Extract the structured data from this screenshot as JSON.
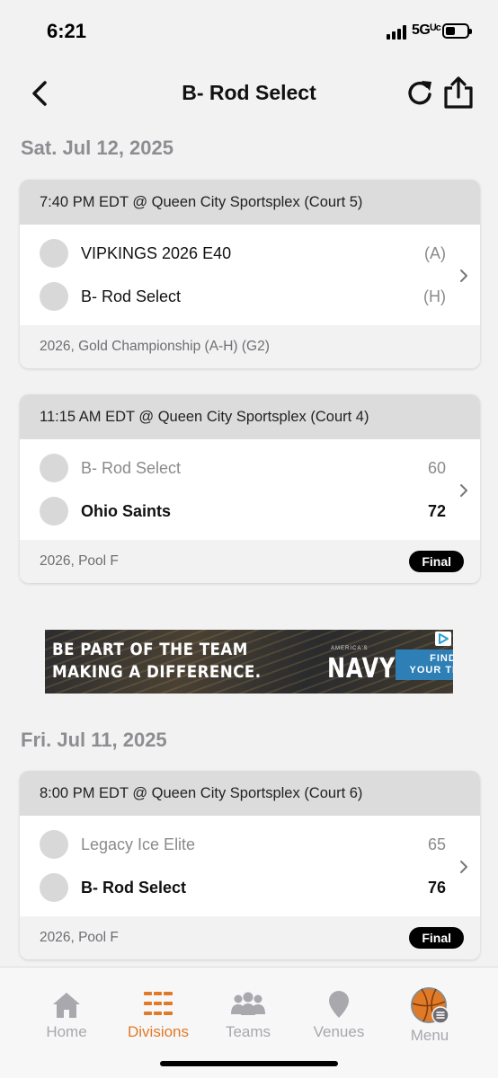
{
  "status_bar": {
    "time": "6:21",
    "network": "5Gᵁᶜ"
  },
  "header": {
    "title": "B- Rod Select",
    "back_icon": "chevron-left-icon",
    "refresh_icon": "refresh-icon",
    "share_icon": "share-icon"
  },
  "sections": [
    {
      "date": "Sat. Jul 12, 2025",
      "games": [
        {
          "header": "7:40 PM EDT @ Queen City Sportsplex (Court 5)",
          "teams": [
            {
              "name": "VIPKINGS 2026 E40",
              "value": "(A)"
            },
            {
              "name": "B- Rod Select",
              "value": "(H)"
            }
          ],
          "footer": "2026, Gold Championship (A-H) (G2)"
        },
        {
          "header": "11:15 AM EDT @ Queen City Sportsplex (Court 4)",
          "teams": [
            {
              "name": "B- Rod Select",
              "value": "60"
            },
            {
              "name": "Ohio Saints",
              "value": "72"
            }
          ],
          "footer": "2026, Pool F",
          "status": "Final"
        }
      ]
    },
    {
      "date": "Fri. Jul 11, 2025",
      "games": [
        {
          "header": "8:00 PM EDT @ Queen City Sportsplex (Court 6)",
          "teams": [
            {
              "name": "Legacy Ice Elite",
              "value": "65"
            },
            {
              "name": "B- Rod Select",
              "value": "76"
            }
          ],
          "footer": "2026, Pool F",
          "status": "Final"
        }
      ]
    }
  ],
  "ad": {
    "line1": "BE PART OF THE TEAM",
    "line2": "MAKING A DIFFERENCE.",
    "brand_small": "AMERICA'S",
    "brand": "NAVY",
    "cta_line1": "FIND",
    "cta_line2": "YOUR TEAM"
  },
  "tabs": [
    {
      "label": "Home",
      "icon": "home-icon"
    },
    {
      "label": "Divisions",
      "icon": "divisions-list-icon",
      "active": true
    },
    {
      "label": "Teams",
      "icon": "teams-icon"
    },
    {
      "label": "Venues",
      "icon": "map-pin-icon"
    },
    {
      "label": "Menu",
      "icon": "basketball-menu-icon"
    }
  ],
  "colors": {
    "accent": "#e07a26",
    "badge_bg": "#000000",
    "card_header_bg": "#dcdcdd"
  }
}
